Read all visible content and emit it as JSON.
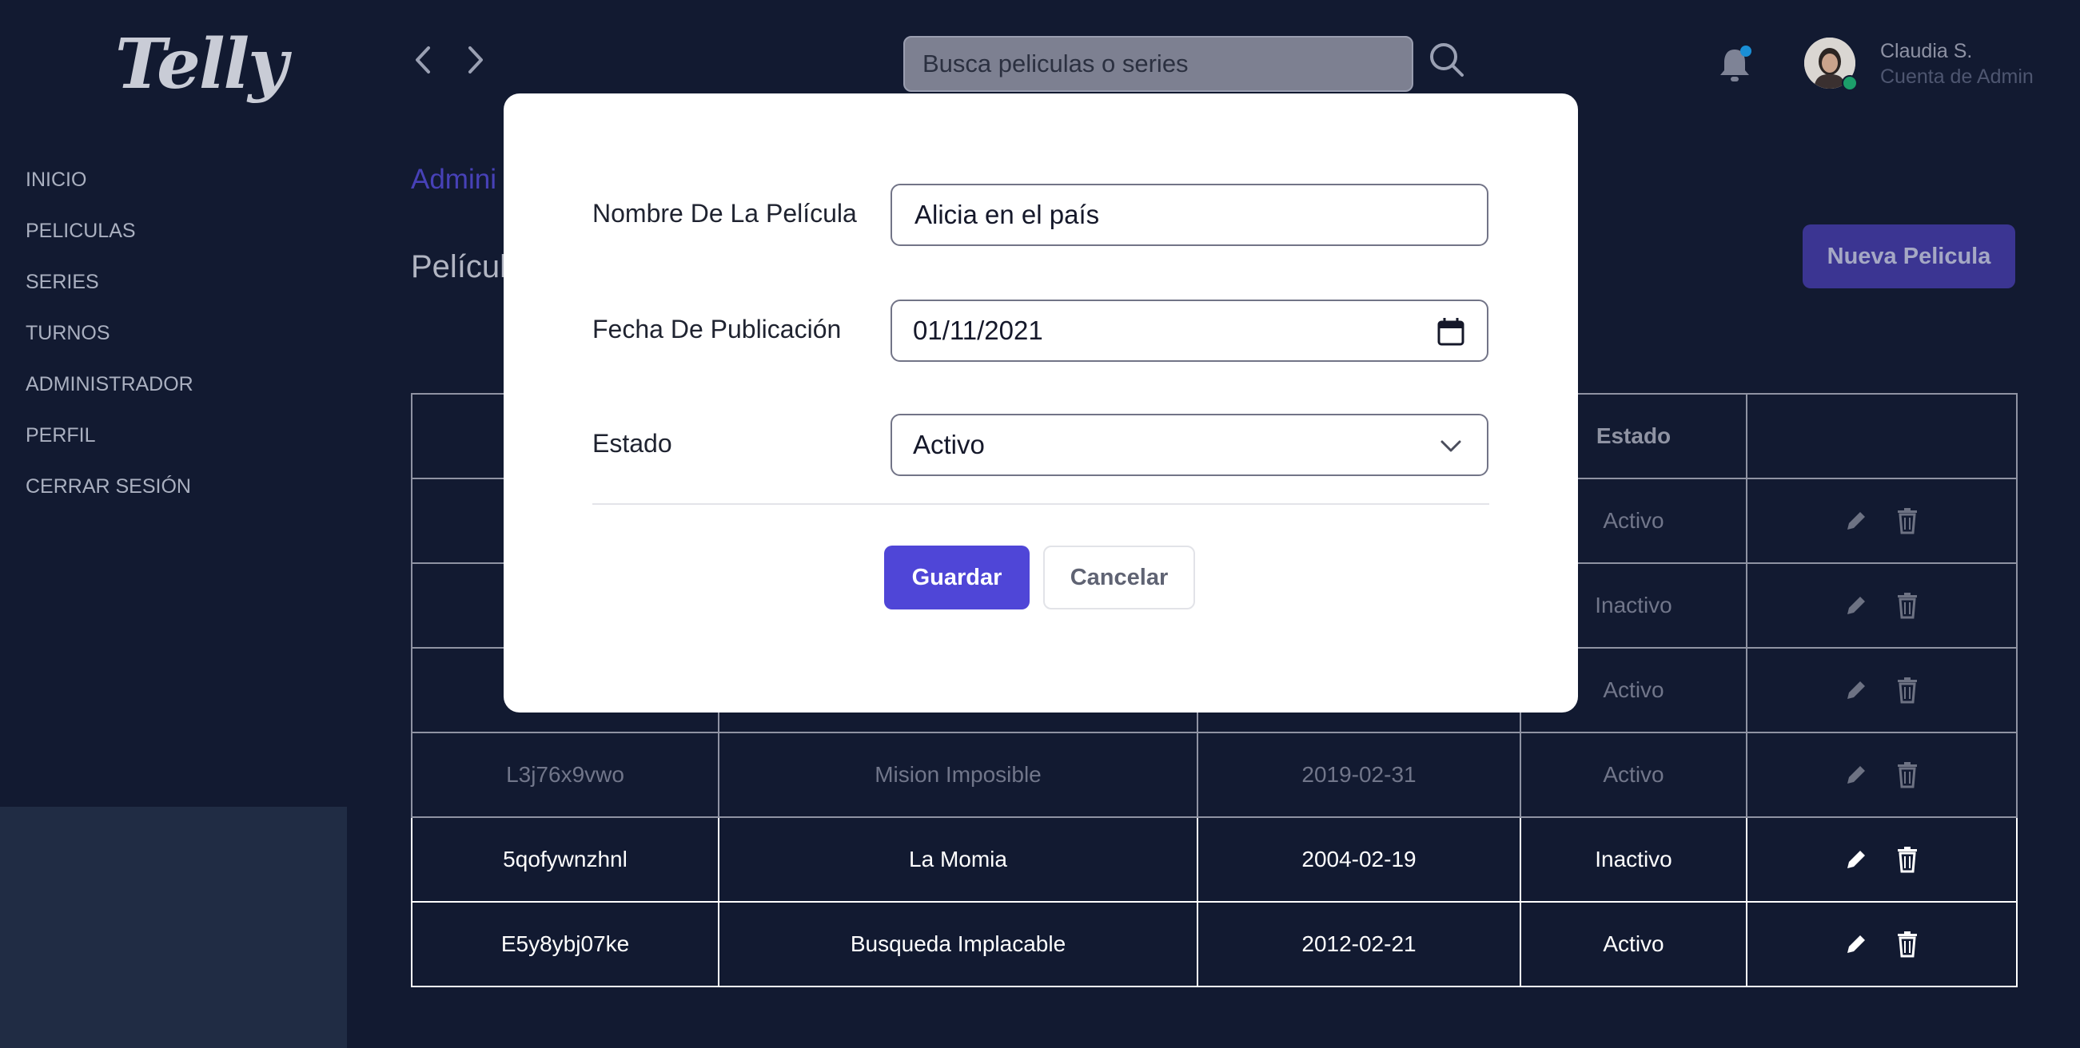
{
  "app": {
    "logo": "Telly"
  },
  "sidebar": {
    "items": [
      {
        "label": "INICIO"
      },
      {
        "label": "PELICULAS"
      },
      {
        "label": "SERIES"
      },
      {
        "label": "TURNOS"
      },
      {
        "label": "ADMINISTRADOR"
      },
      {
        "label": "PERFIL"
      },
      {
        "label": "CERRAR SESIÓN"
      }
    ]
  },
  "header": {
    "search_placeholder": "Busca peliculas o series",
    "user_name": "Claudia S.",
    "user_role": "Cuenta de Admin",
    "icons": [
      "chevron-left-icon",
      "chevron-right-icon",
      "search-icon",
      "bell-icon"
    ],
    "notification_dot_color": "#1a8fd6"
  },
  "main": {
    "breadcrumb": "Admini",
    "title": "Películ",
    "new_button": "Nueva Pelicula",
    "table": {
      "headers": [
        "",
        "",
        "",
        "Estado",
        ""
      ],
      "rows": [
        {
          "id": "",
          "name": "",
          "date": "",
          "status": "Activo"
        },
        {
          "id": "",
          "name": "",
          "date": "",
          "status": "Inactivo"
        },
        {
          "id": "",
          "name": "",
          "date": "",
          "status": "Activo"
        },
        {
          "id": "L3j76x9vwo",
          "name": "Mision Imposible",
          "date": "2019-02-31",
          "status": "Activo"
        },
        {
          "id": "5qofywnzhnl",
          "name": "La Momia",
          "date": "2004-02-19",
          "status": "Inactivo"
        },
        {
          "id": "E5y8ybj07ke",
          "name": "Busqueda Implacable",
          "date": "2012-02-21",
          "status": "Activo"
        }
      ]
    }
  },
  "modal": {
    "fields": {
      "name_label": "Nombre De La Película",
      "name_value": "Alicia en el país",
      "date_label": "Fecha De Publicación",
      "date_value": "01/11/2021",
      "status_label": "Estado",
      "status_value": "Activo"
    },
    "save_button": "Guardar",
    "cancel_button": "Cancelar",
    "accent_color": "#4f46d7"
  }
}
